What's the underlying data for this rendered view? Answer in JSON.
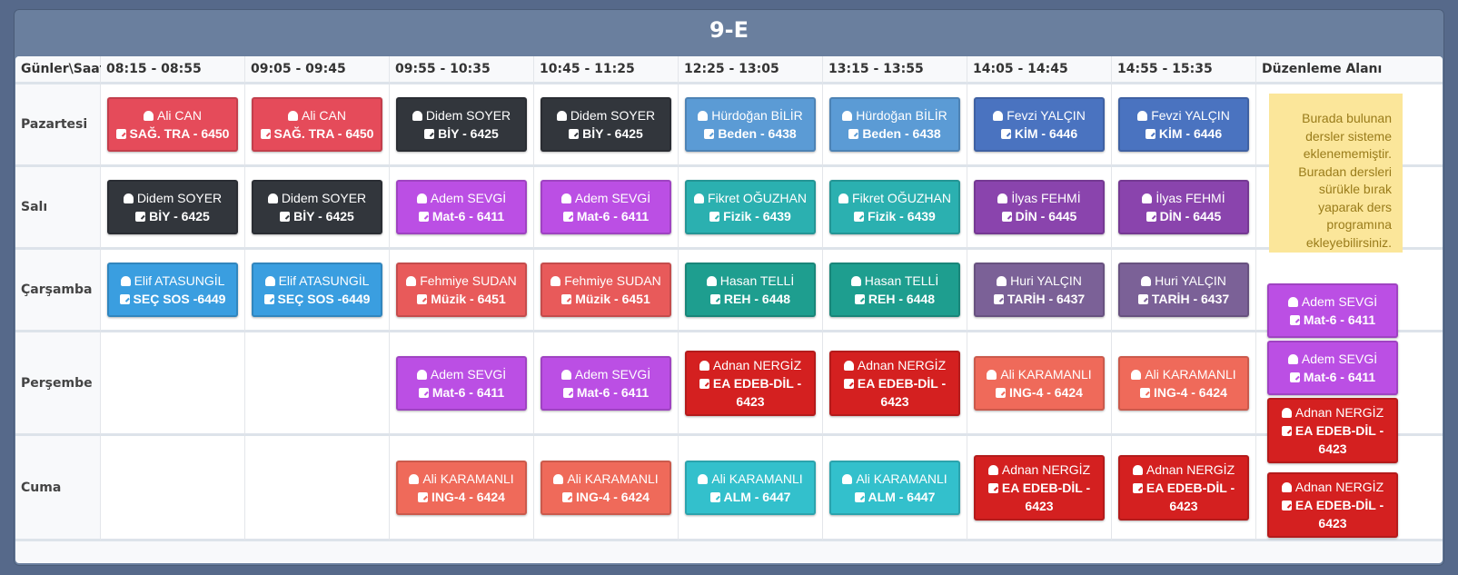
{
  "title": "9-E",
  "header": {
    "corner": "Günler\\Saat",
    "times": [
      "08:15 - 08:55",
      "09:05 - 09:45",
      "09:55 - 10:35",
      "10:45 - 11:25",
      "12:25 - 13:05",
      "13:15 - 13:55",
      "14:05 - 14:45",
      "14:55 - 15:35"
    ],
    "edit_area": "Düzenleme Alanı"
  },
  "days": [
    "Pazartesi",
    "Salı",
    "Çarşamba",
    "Perşembe",
    "Cuma"
  ],
  "colors": {
    "red": "#e54b5a",
    "dark": "#32363c",
    "lightblue": "#5b9bd5",
    "blue": "#4a73c0",
    "purple": "#bb4fe4",
    "teal": "#2bb0b0",
    "violet": "#8a44ad",
    "sky": "#3a9ee0",
    "salmon": "#e85a5a",
    "green": "#1e9e8f",
    "mauve": "#7b6197",
    "crimson": "#d42020",
    "coral": "#ef6a5a",
    "cyan": "#33c0cc"
  },
  "lessons": {
    "r0c0": {
      "teacher": "Ali CAN",
      "course": "SAĞ. TRA - 6450",
      "color": "#e54b5a"
    },
    "r0c1": {
      "teacher": "Ali CAN",
      "course": "SAĞ. TRA - 6450",
      "color": "#e54b5a"
    },
    "r0c2": {
      "teacher": "Didem SOYER",
      "course": "BİY - 6425",
      "color": "#32363c"
    },
    "r0c3": {
      "teacher": "Didem SOYER",
      "course": "BİY - 6425",
      "color": "#32363c"
    },
    "r0c4": {
      "teacher": "Hürdoğan BİLİR",
      "course": "Beden - 6438",
      "color": "#5b9bd5"
    },
    "r0c5": {
      "teacher": "Hürdoğan BİLİR",
      "course": "Beden - 6438",
      "color": "#5b9bd5"
    },
    "r0c6": {
      "teacher": "Fevzi YALÇIN",
      "course": "KİM - 6446",
      "color": "#4a73c0"
    },
    "r0c7": {
      "teacher": "Fevzi YALÇIN",
      "course": "KİM - 6446",
      "color": "#4a73c0"
    },
    "r1c0": {
      "teacher": "Didem SOYER",
      "course": "BİY - 6425",
      "color": "#32363c"
    },
    "r1c1": {
      "teacher": "Didem SOYER",
      "course": "BİY - 6425",
      "color": "#32363c"
    },
    "r1c2": {
      "teacher": "Adem SEVGİ",
      "course": "Mat-6 - 6411",
      "color": "#bb4fe4"
    },
    "r1c3": {
      "teacher": "Adem SEVGİ",
      "course": "Mat-6 - 6411",
      "color": "#bb4fe4"
    },
    "r1c4": {
      "teacher": "Fikret OĞUZHAN",
      "course": "Fizik - 6439",
      "color": "#2bb0b0"
    },
    "r1c5": {
      "teacher": "Fikret OĞUZHAN",
      "course": "Fizik - 6439",
      "color": "#2bb0b0"
    },
    "r1c6": {
      "teacher": "İlyas FEHMİ",
      "course": "DİN - 6445",
      "color": "#8a44ad"
    },
    "r1c7": {
      "teacher": "İlyas FEHMİ",
      "course": "DİN - 6445",
      "color": "#8a44ad"
    },
    "r2c0": {
      "teacher": "Elif ATASUNGİL",
      "course": "SEÇ SOS -6449",
      "color": "#3a9ee0"
    },
    "r2c1": {
      "teacher": "Elif ATASUNGİL",
      "course": "SEÇ SOS -6449",
      "color": "#3a9ee0"
    },
    "r2c2": {
      "teacher": "Fehmiye SUDAN",
      "course": "Müzik - 6451",
      "color": "#e85a5a"
    },
    "r2c3": {
      "teacher": "Fehmiye SUDAN",
      "course": "Müzik - 6451",
      "color": "#e85a5a"
    },
    "r2c4": {
      "teacher": "Hasan TELLİ",
      "course": "REH - 6448",
      "color": "#1e9e8f"
    },
    "r2c5": {
      "teacher": "Hasan TELLİ",
      "course": "REH - 6448",
      "color": "#1e9e8f"
    },
    "r2c6": {
      "teacher": "Huri YALÇIN",
      "course": "TARİH - 6437",
      "color": "#7b6197"
    },
    "r2c7": {
      "teacher": "Huri YALÇIN",
      "course": "TARİH - 6437",
      "color": "#7b6197"
    },
    "r3c2": {
      "teacher": "Adem SEVGİ",
      "course": "Mat-6 - 6411",
      "color": "#bb4fe4"
    },
    "r3c3": {
      "teacher": "Adem SEVGİ",
      "course": "Mat-6 - 6411",
      "color": "#bb4fe4"
    },
    "r3c4": {
      "teacher": "Adnan NERGİZ",
      "course": "EA EDEB-DİL - 6423",
      "color": "#d42020"
    },
    "r3c5": {
      "teacher": "Adnan NERGİZ",
      "course": "EA EDEB-DİL - 6423",
      "color": "#d42020"
    },
    "r3c6": {
      "teacher": "Ali KARAMANLI",
      "course": "ING-4 - 6424",
      "color": "#ef6a5a"
    },
    "r3c7": {
      "teacher": "Ali KARAMANLI",
      "course": "ING-4 - 6424",
      "color": "#ef6a5a"
    },
    "r4c2": {
      "teacher": "Ali KARAMANLI",
      "course": "ING-4 - 6424",
      "color": "#ef6a5a"
    },
    "r4c3": {
      "teacher": "Ali KARAMANLI",
      "course": "ING-4 - 6424",
      "color": "#ef6a5a"
    },
    "r4c4": {
      "teacher": "Ali KARAMANLI",
      "course": "ALM - 6447",
      "color": "#33c0cc"
    },
    "r4c5": {
      "teacher": "Ali KARAMANLI",
      "course": "ALM - 6447",
      "color": "#33c0cc"
    },
    "r4c6": {
      "teacher": "Adnan NERGİZ",
      "course": "EA EDEB-DİL - 6423",
      "color": "#d42020"
    },
    "r4c7": {
      "teacher": "Adnan NERGİZ",
      "course": "EA EDEB-DİL - 6423",
      "color": "#d42020"
    }
  },
  "edit_area": {
    "note": "Burada bulunan dersler sisteme eklenememiştir. Buradan dersleri sürükle bırak yaparak ders programına ekleyebilirsiniz.",
    "pending": [
      {
        "teacher": "Adem SEVGİ",
        "course": "Mat-6 - 6411",
        "color": "#bb4fe4"
      },
      {
        "teacher": "Adem SEVGİ",
        "course": "Mat-6 - 6411",
        "color": "#bb4fe4"
      },
      {
        "teacher": "Adnan NERGİZ",
        "course": "EA EDEB-DİL - 6423",
        "color": "#d42020"
      },
      {
        "teacher": "Adnan NERGİZ",
        "course": "EA EDEB-DİL - 6423",
        "color": "#d42020"
      }
    ]
  }
}
